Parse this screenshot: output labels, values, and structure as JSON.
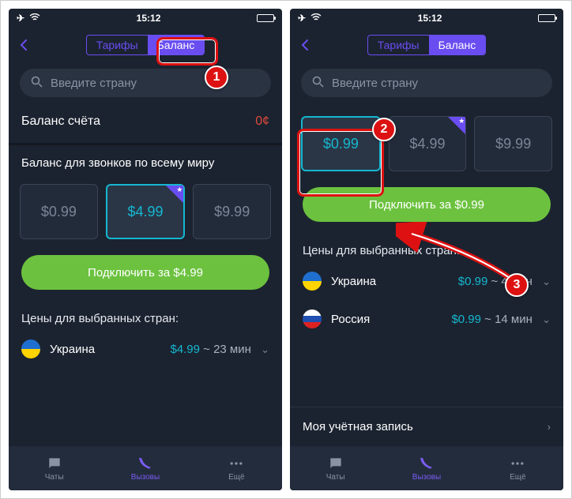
{
  "statusbar": {
    "time": "15:12"
  },
  "seg": {
    "tariffs": "Тарифы",
    "balance": "Баланс"
  },
  "search": {
    "placeholder": "Введите страну"
  },
  "left": {
    "balance_label": "Баланс счёта",
    "balance_value": "0¢",
    "worldwide_title": "Баланс для звонков по всему миру",
    "prices": {
      "p0": "$0.99",
      "p1": "$4.99",
      "p2": "$9.99"
    },
    "cta": "Подключить за $4.99",
    "list_title": "Цены для выбранных стран:",
    "ukraine": "Украина",
    "uk_price": "$4.99",
    "uk_time": "~ 23 мин"
  },
  "right": {
    "prices": {
      "p0": "$0.99",
      "p1": "$4.99",
      "p2": "$9.99"
    },
    "cta": "Подключить за $0.99",
    "list_title": "Цены для выбранных стран:",
    "ukraine": "Украина",
    "uk_price": "$0.99",
    "uk_time": "~ 4 мин",
    "russia": "Россия",
    "ru_price": "$0.99",
    "ru_time": "~ 14 мин",
    "account": "Моя учётная запись"
  },
  "tabs": {
    "chats": "Чаты",
    "calls": "Вызовы",
    "more": "Ещё"
  },
  "callouts": {
    "n1": "1",
    "n2": "2",
    "n3": "3"
  }
}
